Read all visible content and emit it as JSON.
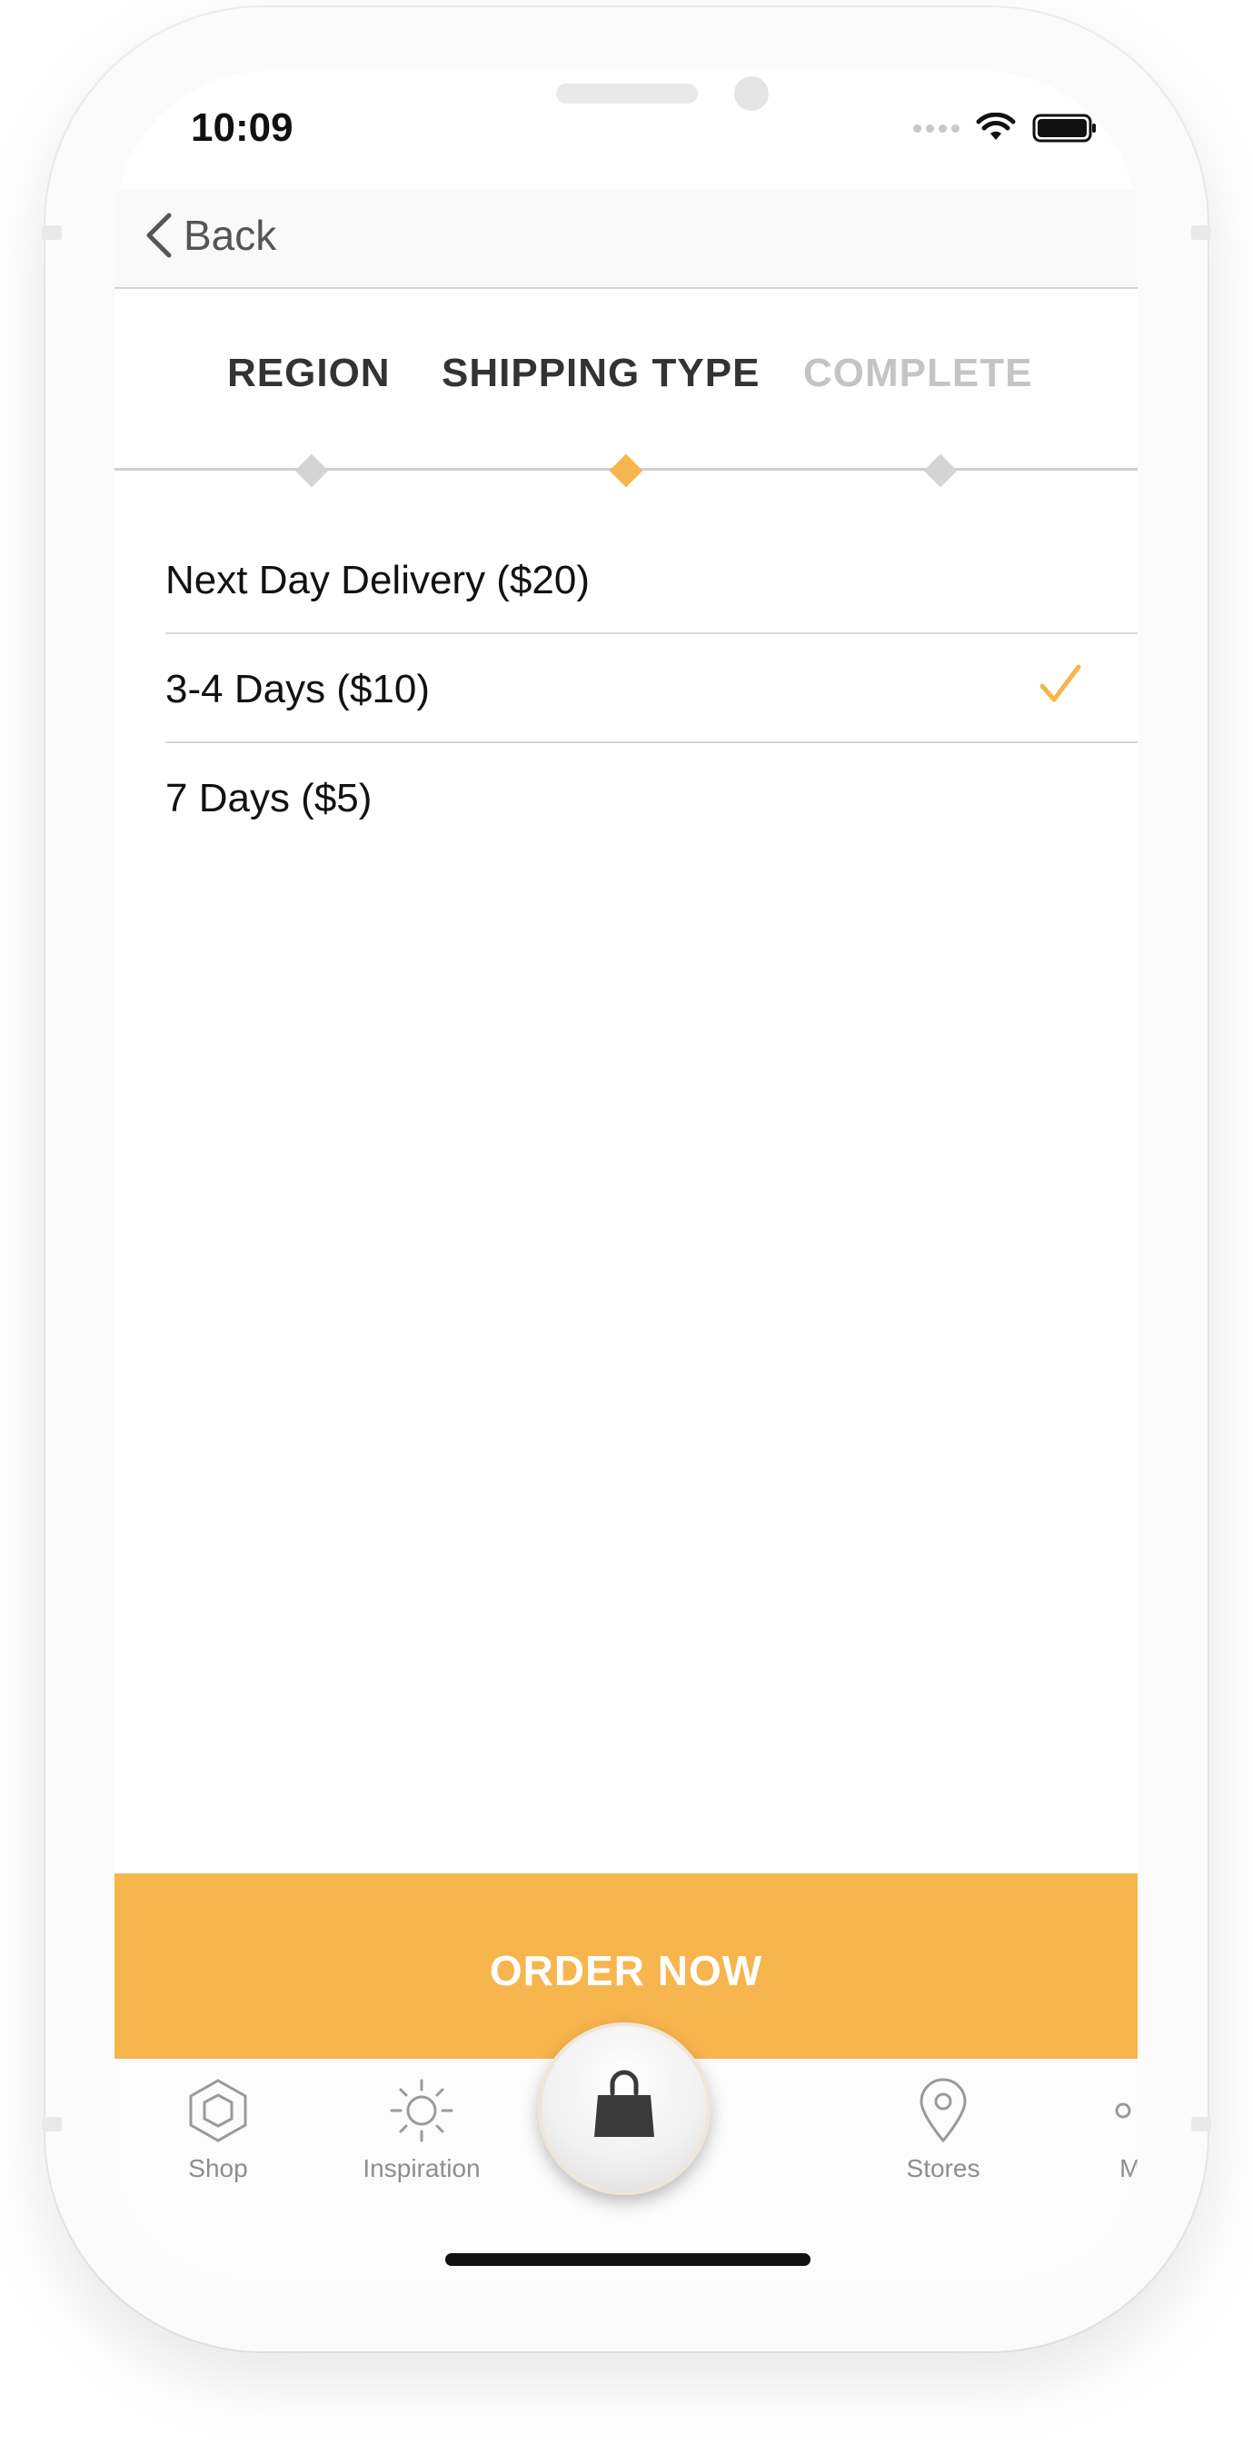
{
  "status_bar": {
    "time": "10:09"
  },
  "nav": {
    "back_label": "Back"
  },
  "steps": [
    {
      "label": "REGION",
      "state": "done"
    },
    {
      "label": "SHIPPING TYPE",
      "state": "current"
    },
    {
      "label": "COMPLETE",
      "state": "upcoming"
    }
  ],
  "shipping_options": [
    {
      "label": "Next Day Delivery ($20)",
      "selected": false
    },
    {
      "label": "3-4 Days ($10)",
      "selected": true
    },
    {
      "label": "7 Days ($5)",
      "selected": false
    }
  ],
  "order_button": {
    "label": "ORDER NOW"
  },
  "tab_bar": {
    "items": [
      {
        "label": "Shop",
        "icon": "hexagon-icon"
      },
      {
        "label": "Inspiration",
        "icon": "sun-icon"
      },
      {
        "label": "",
        "icon": "shopping-bag-icon"
      },
      {
        "label": "Stores",
        "icon": "location-pin-icon"
      },
      {
        "label": "More",
        "icon": "more-dots-icon"
      }
    ]
  },
  "colors": {
    "accent": "#F7B54D",
    "text_dark": "#333333",
    "text_muted": "#C4C4C4",
    "diamond_inactive": "#D4D4D4"
  }
}
